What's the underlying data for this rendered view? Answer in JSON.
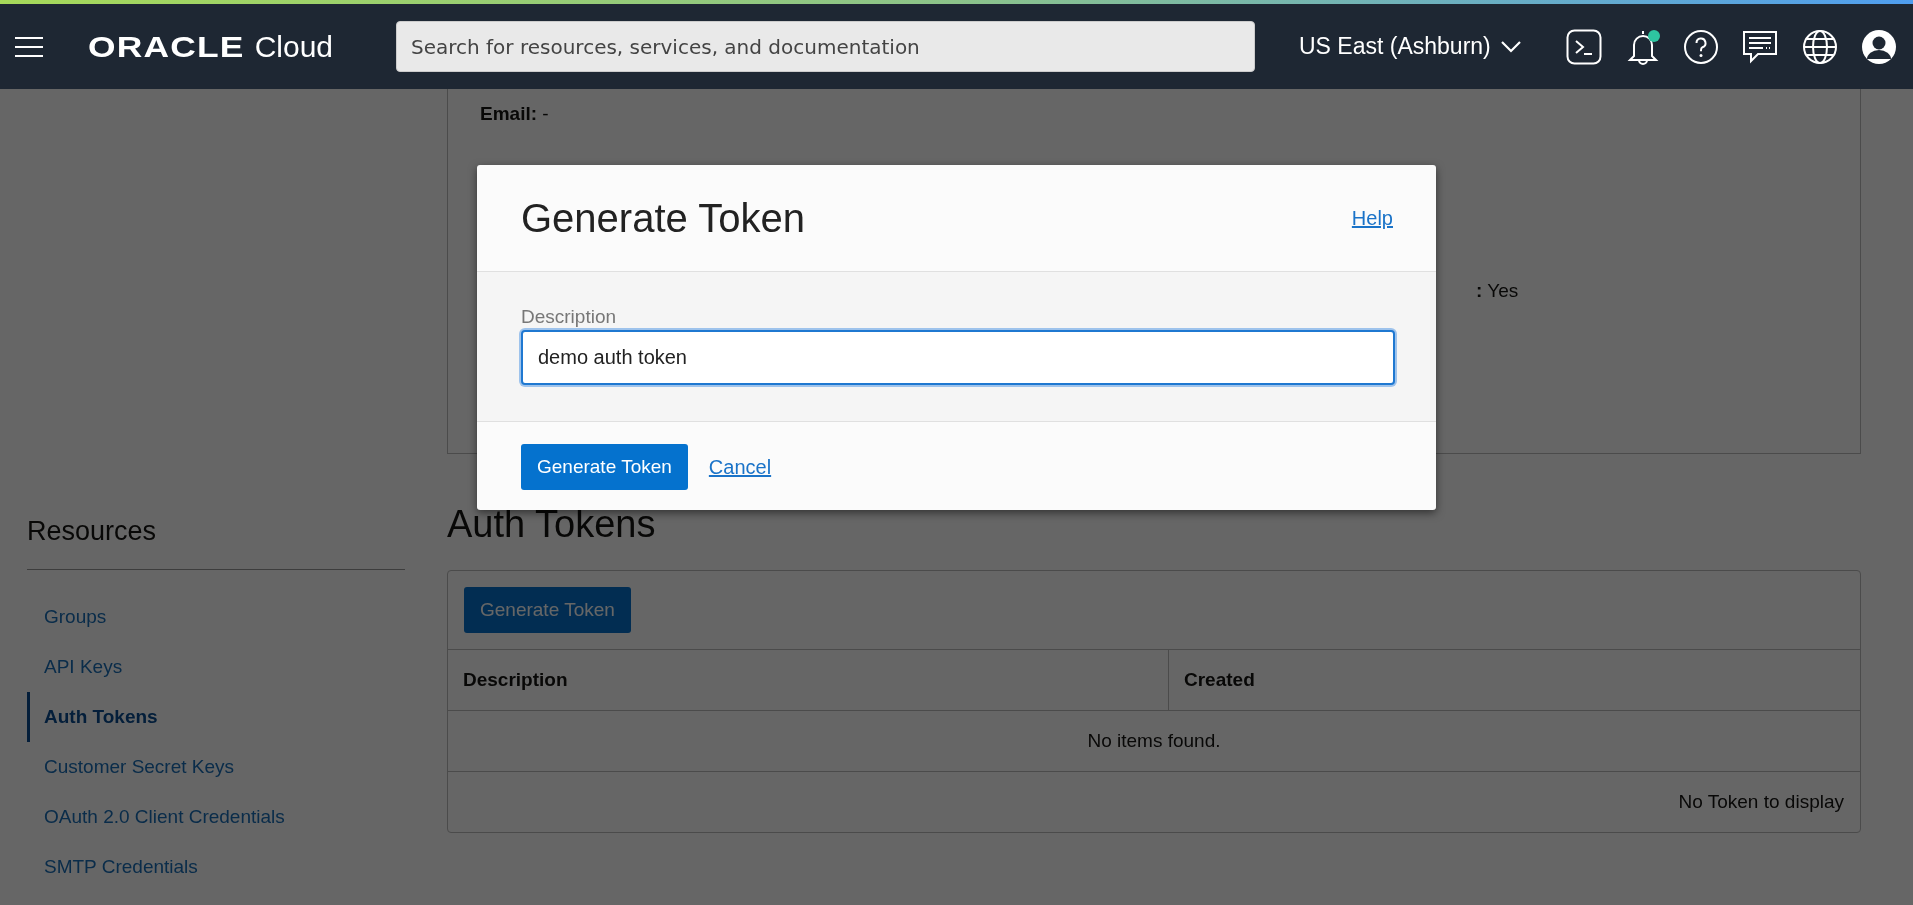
{
  "header": {
    "brand": "ORACLE",
    "product": "Cloud",
    "search": {
      "placeholder": "Search for resources, services, and documentation"
    },
    "region": "US East (Ashburn)",
    "notifications_unread": true
  },
  "details": {
    "email_label": "Email:",
    "email_value": "-",
    "field_tail": {
      "label": ":",
      "value": "Yes"
    }
  },
  "sidebar": {
    "title": "Resources",
    "items": [
      {
        "label": "Groups",
        "selected": false
      },
      {
        "label": "API Keys",
        "selected": false
      },
      {
        "label": "Auth Tokens",
        "selected": true
      },
      {
        "label": "Customer Secret Keys",
        "selected": false
      },
      {
        "label": "OAuth 2.0 Client Credentials",
        "selected": false
      },
      {
        "label": "SMTP Credentials",
        "selected": false
      }
    ]
  },
  "main": {
    "title": "Auth Tokens",
    "toolbar_button": "Generate Token",
    "table": {
      "columns": [
        "Description",
        "Created"
      ],
      "empty_message": "No items found.",
      "footer": "No Token to display"
    }
  },
  "modal": {
    "title": "Generate Token",
    "help_link": "Help",
    "field": {
      "label": "Description",
      "value": "demo auth token",
      "focused": true
    },
    "primary_button": "Generate Token",
    "cancel_link": "Cancel"
  }
}
